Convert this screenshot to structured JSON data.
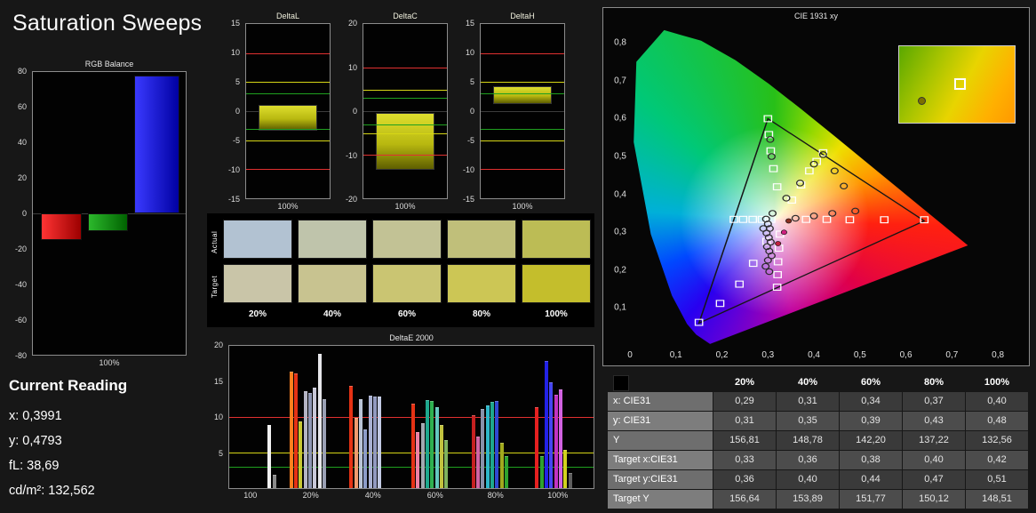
{
  "page": {
    "title": "Saturation Sweeps"
  },
  "current_reading": {
    "heading": "Current Reading",
    "lines": [
      "x: 0,3991",
      "y: 0,4793",
      "fL: 38,69",
      "cd/m²: 132,562"
    ]
  },
  "chart_data": [
    {
      "id": "rgb_balance",
      "type": "bar",
      "title": "RGB Balance",
      "xlabel": "100%",
      "ylim": [
        -80,
        80
      ],
      "yticks": [
        80,
        60,
        40,
        20,
        0,
        -20,
        -40,
        -60,
        -80
      ],
      "categories": [
        "Red",
        "Green",
        "Blue"
      ],
      "values": [
        -15,
        -10,
        78
      ],
      "colors": [
        [
          "#ff3434",
          "#9c0000"
        ],
        [
          "#2cb82c",
          "#006200"
        ],
        [
          "#3a3aff",
          "#0000a2"
        ]
      ]
    },
    {
      "id": "delta_l",
      "type": "bar",
      "title": "DeltaL",
      "xlabel": "100%",
      "ylim": [
        -15,
        15
      ],
      "yticks": [
        15,
        10,
        5,
        0,
        -5,
        -10,
        -15
      ],
      "ref_lines": [
        {
          "v": 10,
          "color": "#e03030"
        },
        {
          "v": 5,
          "color": "#d6d616"
        },
        {
          "v": 3,
          "color": "#1fa01f"
        },
        {
          "v": -3,
          "color": "#1fa01f"
        },
        {
          "v": -5,
          "color": "#d6d616"
        },
        {
          "v": -10,
          "color": "#e03030"
        }
      ],
      "bar": {
        "from": 1.0,
        "to": -3.3
      }
    },
    {
      "id": "delta_c",
      "type": "bar",
      "title": "DeltaC",
      "xlabel": "100%",
      "ylim": [
        -20,
        20
      ],
      "yticks": [
        20,
        10,
        0,
        -10,
        -20
      ],
      "ref_lines": [
        {
          "v": 10,
          "color": "#e03030"
        },
        {
          "v": 5,
          "color": "#d6d616"
        },
        {
          "v": 3,
          "color": "#1fa01f"
        },
        {
          "v": -3,
          "color": "#1fa01f"
        },
        {
          "v": -5,
          "color": "#d6d616"
        },
        {
          "v": -10,
          "color": "#e03030"
        }
      ],
      "bar": {
        "from": -0.5,
        "to": -13.5
      }
    },
    {
      "id": "delta_h",
      "type": "bar",
      "title": "DeltaH",
      "xlabel": "100%",
      "ylim": [
        -15,
        15
      ],
      "yticks": [
        15,
        10,
        5,
        0,
        -5,
        -10,
        -15
      ],
      "ref_lines": [
        {
          "v": 10,
          "color": "#e03030"
        },
        {
          "v": 5,
          "color": "#d6d616"
        },
        {
          "v": 3,
          "color": "#1fa01f"
        },
        {
          "v": -3,
          "color": "#1fa01f"
        },
        {
          "v": -5,
          "color": "#d6d616"
        },
        {
          "v": -10,
          "color": "#e03030"
        }
      ],
      "bar": {
        "from": 4.3,
        "to": 1.3
      }
    },
    {
      "id": "saturation_swatches",
      "type": "table",
      "categories": [
        "20%",
        "40%",
        "60%",
        "80%",
        "100%"
      ],
      "rows": [
        {
          "label": "Actual",
          "colors": [
            "#b2c2d2",
            "#bfc4ab",
            "#c2c295",
            "#c0bf7a",
            "#bcbc55"
          ]
        },
        {
          "label": "Target",
          "colors": [
            "#c9c5a8",
            "#c8c390",
            "#cac572",
            "#ccc655",
            "#c4be2c"
          ]
        }
      ]
    },
    {
      "id": "delta_e_2000",
      "type": "bar",
      "title": "DeltaE 2000",
      "ylim": [
        0,
        20
      ],
      "yticks": [
        20,
        15,
        10,
        5
      ],
      "ref_lines": [
        {
          "v": 10,
          "color": "#e03030"
        },
        {
          "v": 5,
          "color": "#d6d616"
        },
        {
          "v": 3,
          "color": "#1fa01f"
        }
      ],
      "xticks": [
        {
          "x": 0.06,
          "label": "100"
        },
        {
          "x": 0.225,
          "label": "20%"
        },
        {
          "x": 0.395,
          "label": "40%"
        },
        {
          "x": 0.565,
          "label": "60%"
        },
        {
          "x": 0.73,
          "label": "80%"
        },
        {
          "x": 0.9,
          "label": "100%"
        }
      ],
      "bars": [
        {
          "x": 0.105,
          "v": 8.7,
          "c": "#f2f2f2"
        },
        {
          "x": 0.12,
          "v": 1.8,
          "c": "#8a8a8a"
        },
        {
          "x": 0.165,
          "v": 16.3,
          "c": "#ff7f1e"
        },
        {
          "x": 0.178,
          "v": 16.0,
          "c": "#e63214"
        },
        {
          "x": 0.191,
          "v": 9.3,
          "c": "#c8c832"
        },
        {
          "x": 0.204,
          "v": 13.5,
          "c": "#b4b4c4"
        },
        {
          "x": 0.217,
          "v": 13.2,
          "c": "#8e96b4"
        },
        {
          "x": 0.23,
          "v": 14.0,
          "c": "#c8c8d8"
        },
        {
          "x": 0.243,
          "v": 18.8,
          "c": "#e6e6ea"
        },
        {
          "x": 0.256,
          "v": 12.4,
          "c": "#9aa0b4"
        },
        {
          "x": 0.33,
          "v": 14.2,
          "c": "#e63214"
        },
        {
          "x": 0.343,
          "v": 9.8,
          "c": "#f09a6e"
        },
        {
          "x": 0.356,
          "v": 12.4,
          "c": "#b9c4d7"
        },
        {
          "x": 0.369,
          "v": 8.1,
          "c": "#8c9cc8"
        },
        {
          "x": 0.382,
          "v": 12.9,
          "c": "#a9b1d2"
        },
        {
          "x": 0.395,
          "v": 12.7,
          "c": "#929ac0"
        },
        {
          "x": 0.408,
          "v": 12.8,
          "c": "#c2cae4"
        },
        {
          "x": 0.5,
          "v": 11.8,
          "c": "#e63214"
        },
        {
          "x": 0.513,
          "v": 7.8,
          "c": "#ef82a5"
        },
        {
          "x": 0.526,
          "v": 9.0,
          "c": "#a2aab2"
        },
        {
          "x": 0.539,
          "v": 12.3,
          "c": "#1ea88e"
        },
        {
          "x": 0.552,
          "v": 12.1,
          "c": "#2eb050"
        },
        {
          "x": 0.565,
          "v": 11.2,
          "c": "#64c8c0"
        },
        {
          "x": 0.578,
          "v": 8.7,
          "c": "#c2c23e"
        },
        {
          "x": 0.591,
          "v": 6.6,
          "c": "#7eb25e"
        },
        {
          "x": 0.665,
          "v": 10.1,
          "c": "#c62020"
        },
        {
          "x": 0.678,
          "v": 7.1,
          "c": "#d264a4"
        },
        {
          "x": 0.691,
          "v": 11.0,
          "c": "#8892aa"
        },
        {
          "x": 0.704,
          "v": 11.5,
          "c": "#2eb8ca"
        },
        {
          "x": 0.717,
          "v": 12.0,
          "c": "#1ea88e"
        },
        {
          "x": 0.73,
          "v": 12.1,
          "c": "#3048d2"
        },
        {
          "x": 0.743,
          "v": 6.3,
          "c": "#a2aa1e"
        },
        {
          "x": 0.756,
          "v": 4.4,
          "c": "#2ea22e"
        },
        {
          "x": 0.84,
          "v": 11.3,
          "c": "#e62020"
        },
        {
          "x": 0.853,
          "v": 4.4,
          "c": "#2ea22e"
        },
        {
          "x": 0.866,
          "v": 17.8,
          "c": "#2222e6"
        },
        {
          "x": 0.879,
          "v": 14.8,
          "c": "#4646f2"
        },
        {
          "x": 0.892,
          "v": 13.0,
          "c": "#c232c2"
        },
        {
          "x": 0.905,
          "v": 13.7,
          "c": "#d262e2"
        },
        {
          "x": 0.918,
          "v": 5.2,
          "c": "#d2d21e"
        },
        {
          "x": 0.931,
          "v": 2.0,
          "c": "#5e5e5e"
        }
      ]
    },
    {
      "id": "cie_1931",
      "type": "scatter",
      "title": "CIE 1931 xy",
      "xlim": [
        0,
        0.85
      ],
      "ylim": [
        0,
        0.85
      ],
      "xticks": [
        {
          "v": 0,
          "label": "0"
        },
        {
          "v": 0.1,
          "label": "0,1"
        },
        {
          "v": 0.2,
          "label": "0,2"
        },
        {
          "v": 0.3,
          "label": "0,3"
        },
        {
          "v": 0.4,
          "label": "0,4"
        },
        {
          "v": 0.5,
          "label": "0,5"
        },
        {
          "v": 0.6,
          "label": "0,6"
        },
        {
          "v": 0.7,
          "label": "0,7"
        },
        {
          "v": 0.8,
          "label": "0,8"
        }
      ],
      "yticks": [
        {
          "v": 0.1,
          "label": "0,1"
        },
        {
          "v": 0.2,
          "label": "0,2"
        },
        {
          "v": 0.3,
          "label": "0,3"
        },
        {
          "v": 0.4,
          "label": "0,4"
        },
        {
          "v": 0.5,
          "label": "0,5"
        },
        {
          "v": 0.6,
          "label": "0,6"
        },
        {
          "v": 0.7,
          "label": "0,7"
        },
        {
          "v": 0.8,
          "label": "0,8"
        }
      ],
      "locus": [
        [
          0.1741,
          0.005
        ],
        [
          0.144,
          0.0297
        ],
        [
          0.1241,
          0.0578
        ],
        [
          0.0913,
          0.1327
        ],
        [
          0.0454,
          0.295
        ],
        [
          0.0082,
          0.5384
        ],
        [
          0.0139,
          0.7502
        ],
        [
          0.0743,
          0.8338
        ],
        [
          0.1547,
          0.8059
        ],
        [
          0.2296,
          0.7543
        ],
        [
          0.3016,
          0.6923
        ],
        [
          0.3731,
          0.6245
        ],
        [
          0.4441,
          0.5547
        ],
        [
          0.5125,
          0.4866
        ],
        [
          0.5752,
          0.4242
        ],
        [
          0.627,
          0.3725
        ],
        [
          0.6915,
          0.3083
        ],
        [
          0.7347,
          0.2653
        ]
      ],
      "triangle": [
        [
          0.64,
          0.33
        ],
        [
          0.3,
          0.6
        ],
        [
          0.15,
          0.06
        ]
      ],
      "squares": [
        [
          0.383,
          0.334
        ],
        [
          0.428,
          0.334
        ],
        [
          0.478,
          0.333
        ],
        [
          0.553,
          0.333
        ],
        [
          0.64,
          0.333
        ],
        [
          0.32,
          0.42
        ],
        [
          0.312,
          0.468
        ],
        [
          0.306,
          0.515
        ],
        [
          0.302,
          0.558
        ],
        [
          0.3,
          0.6
        ],
        [
          0.297,
          0.276
        ],
        [
          0.268,
          0.218
        ],
        [
          0.238,
          0.163
        ],
        [
          0.196,
          0.112
        ],
        [
          0.15,
          0.062
        ],
        [
          0.352,
          0.385
        ],
        [
          0.372,
          0.425
        ],
        [
          0.39,
          0.462
        ],
        [
          0.406,
          0.487
        ],
        [
          0.42,
          0.51
        ],
        [
          0.307,
          0.334
        ],
        [
          0.287,
          0.334
        ],
        [
          0.267,
          0.334
        ],
        [
          0.246,
          0.334
        ],
        [
          0.226,
          0.334
        ],
        [
          0.326,
          0.295
        ],
        [
          0.324,
          0.258
        ],
        [
          0.322,
          0.222
        ],
        [
          0.321,
          0.188
        ],
        [
          0.32,
          0.155
        ]
      ],
      "circles": [
        [
          0.29,
          0.31
        ],
        [
          0.31,
          0.35
        ],
        [
          0.34,
          0.39
        ],
        [
          0.37,
          0.43
        ],
        [
          0.4,
          0.48
        ],
        [
          0.36,
          0.337
        ],
        [
          0.4,
          0.343
        ],
        [
          0.44,
          0.35
        ],
        [
          0.49,
          0.356
        ],
        [
          0.42,
          0.505
        ],
        [
          0.445,
          0.462
        ],
        [
          0.465,
          0.422
        ],
        [
          0.305,
          0.545
        ],
        [
          0.308,
          0.5
        ],
        [
          0.296,
          0.335
        ],
        [
          0.3,
          0.322
        ],
        [
          0.304,
          0.31
        ],
        [
          0.297,
          0.298
        ],
        [
          0.302,
          0.286
        ],
        [
          0.306,
          0.274
        ],
        [
          0.298,
          0.262
        ],
        [
          0.303,
          0.25
        ],
        [
          0.308,
          0.238
        ],
        [
          0.3,
          0.226
        ],
        [
          0.295,
          0.21
        ],
        [
          0.303,
          0.196
        ]
      ],
      "dots": [
        {
          "x": 0.335,
          "y": 0.3,
          "color": "#d02080"
        },
        {
          "x": 0.322,
          "y": 0.27,
          "color": "#c02040"
        },
        {
          "x": 0.345,
          "y": 0.33,
          "color": "#8a3020"
        }
      ]
    },
    {
      "id": "sweep_table",
      "type": "table",
      "headers": [
        "20%",
        "40%",
        "60%",
        "80%",
        "100%"
      ],
      "rows": [
        {
          "label": "x: CIE31",
          "values": [
            "0,29",
            "0,31",
            "0,34",
            "0,37",
            "0,40"
          ]
        },
        {
          "label": "y: CIE31",
          "values": [
            "0,31",
            "0,35",
            "0,39",
            "0,43",
            "0,48"
          ]
        },
        {
          "label": "Y",
          "values": [
            "156,81",
            "148,78",
            "142,20",
            "137,22",
            "132,56"
          ]
        },
        {
          "label": "Target x:CIE31",
          "values": [
            "0,33",
            "0,36",
            "0,38",
            "0,40",
            "0,42"
          ]
        },
        {
          "label": "Target y:CIE31",
          "values": [
            "0,36",
            "0,40",
            "0,44",
            "0,47",
            "0,51"
          ]
        },
        {
          "label": "Target Y",
          "values": [
            "156,64",
            "153,89",
            "151,77",
            "150,12",
            "148,51"
          ]
        }
      ]
    }
  ]
}
